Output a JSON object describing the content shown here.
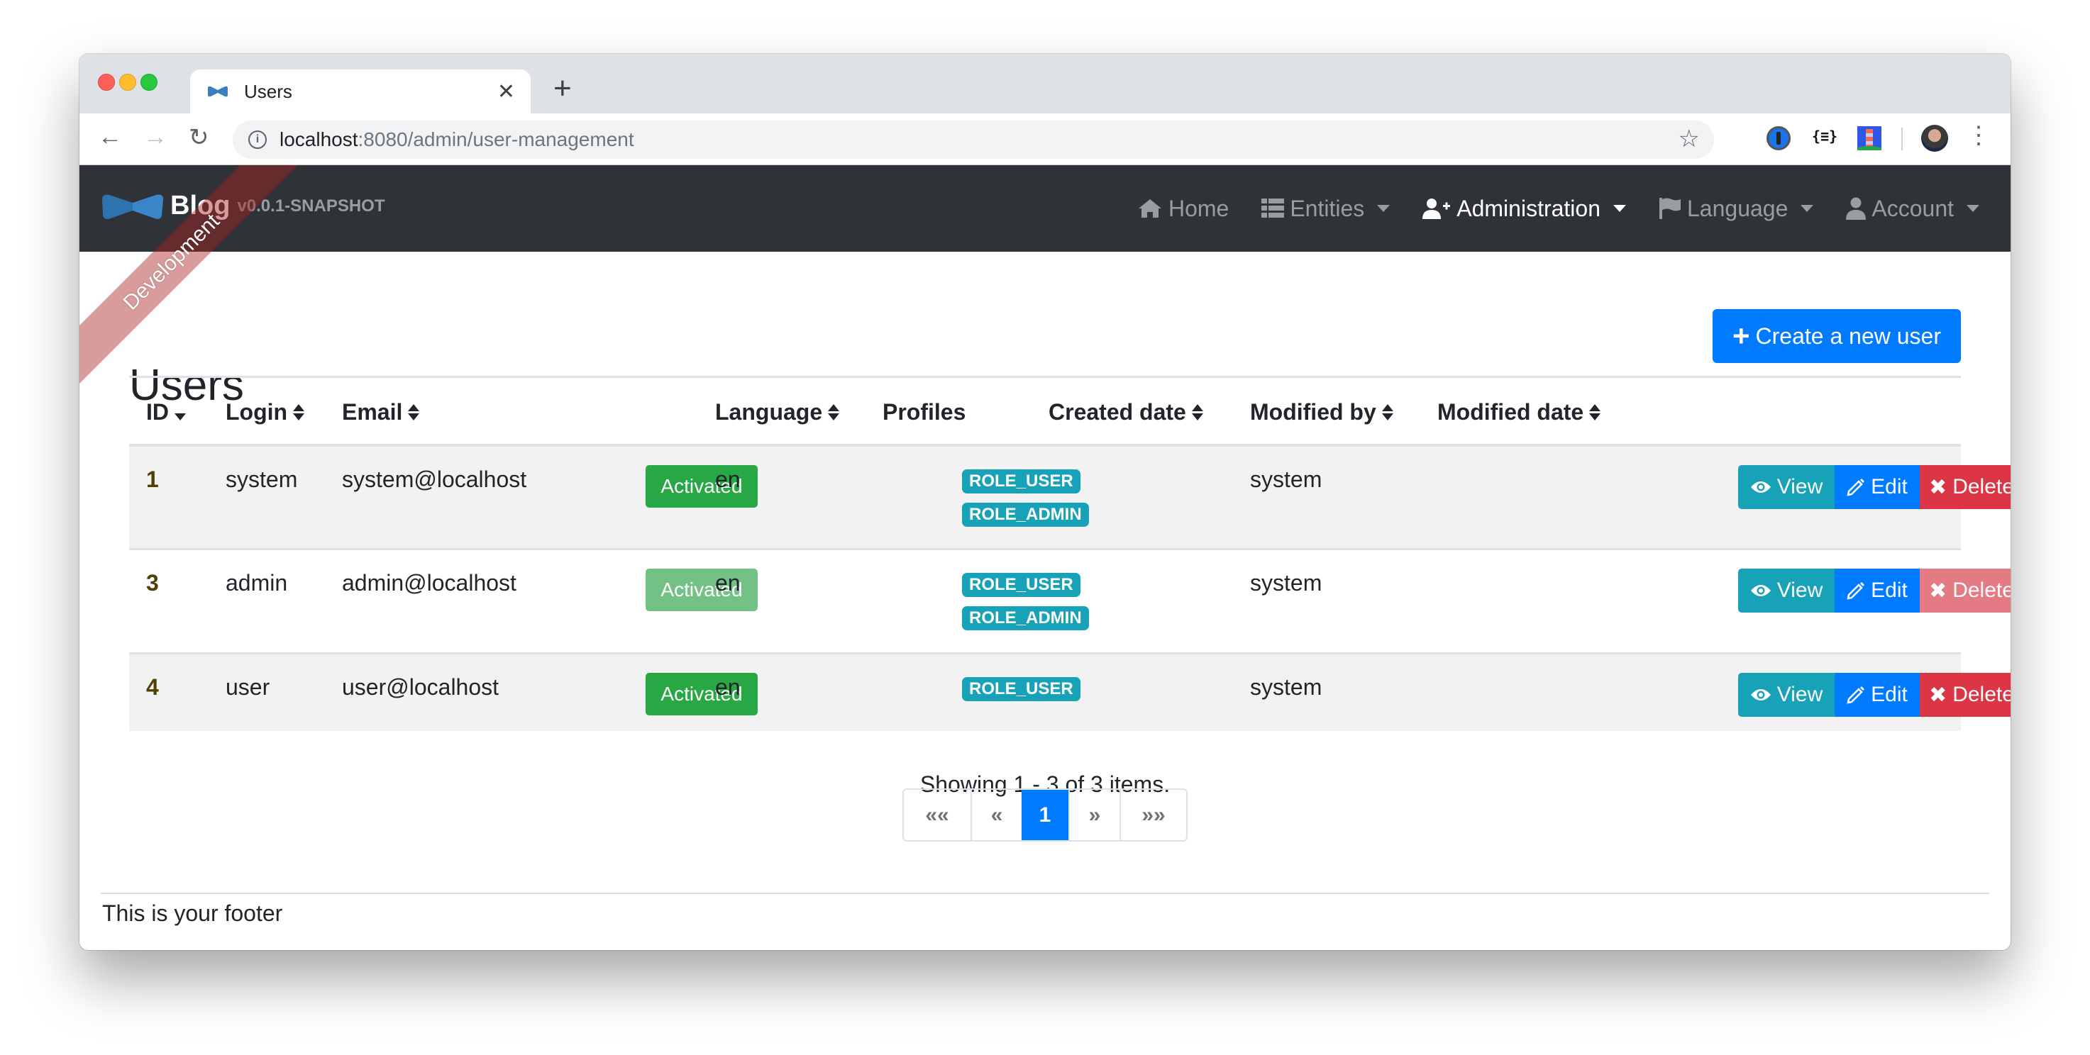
{
  "browser": {
    "tab_title": "Users",
    "url_host": "localhost",
    "url_rest": ":8080/admin/user-management",
    "extensions": [
      "1password-icon",
      "json-formatter-icon",
      "lighthouse-icon"
    ]
  },
  "navbar": {
    "brand_title": "Blog",
    "brand_version": "v0.0.1-SNAPSHOT",
    "ribbon": "Development",
    "items": [
      {
        "label": "Home",
        "icon": "home-icon",
        "dropdown": false,
        "active": false
      },
      {
        "label": "Entities",
        "icon": "th-list-icon",
        "dropdown": true,
        "active": false
      },
      {
        "label": "Administration",
        "icon": "user-plus-icon",
        "dropdown": true,
        "active": true
      },
      {
        "label": "Language",
        "icon": "flag-icon",
        "dropdown": true,
        "active": false
      },
      {
        "label": "Account",
        "icon": "user-icon",
        "dropdown": true,
        "active": false
      }
    ]
  },
  "page": {
    "title": "Users",
    "create_button": "Create a new user"
  },
  "table": {
    "columns": [
      "ID",
      "Login",
      "Email",
      "",
      "Language",
      "Profiles",
      "Created date",
      "Modified by",
      "Modified date",
      ""
    ],
    "rows": [
      {
        "id": "1",
        "login": "system",
        "email": "system@localhost",
        "status": "Activated",
        "status_enabled": true,
        "language": "en",
        "profiles": [
          "ROLE_USER",
          "ROLE_ADMIN"
        ],
        "created_date": "",
        "modified_by": "system",
        "modified_date": "",
        "delete_enabled": true
      },
      {
        "id": "3",
        "login": "admin",
        "email": "admin@localhost",
        "status": "Activated",
        "status_enabled": false,
        "language": "en",
        "profiles": [
          "ROLE_USER",
          "ROLE_ADMIN"
        ],
        "created_date": "",
        "modified_by": "system",
        "modified_date": "",
        "delete_enabled": false
      },
      {
        "id": "4",
        "login": "user",
        "email": "user@localhost",
        "status": "Activated",
        "status_enabled": true,
        "language": "en",
        "profiles": [
          "ROLE_USER"
        ],
        "created_date": "",
        "modified_by": "system",
        "modified_date": "",
        "delete_enabled": true
      }
    ],
    "actions": {
      "view": "View",
      "edit": "Edit",
      "delete": "Delete"
    }
  },
  "pagination": {
    "summary": "Showing 1 - 3 of 3 items.",
    "first": "««",
    "prev": "«",
    "current": "1",
    "next": "»",
    "last": "»»"
  },
  "footer": {
    "text": "This is your footer"
  },
  "colors": {
    "primary": "#007bff",
    "success": "#28a745",
    "info": "#17a2b8",
    "danger": "#dc3545",
    "navbar_bg": "#2f3337",
    "id_link": "#533f03"
  }
}
